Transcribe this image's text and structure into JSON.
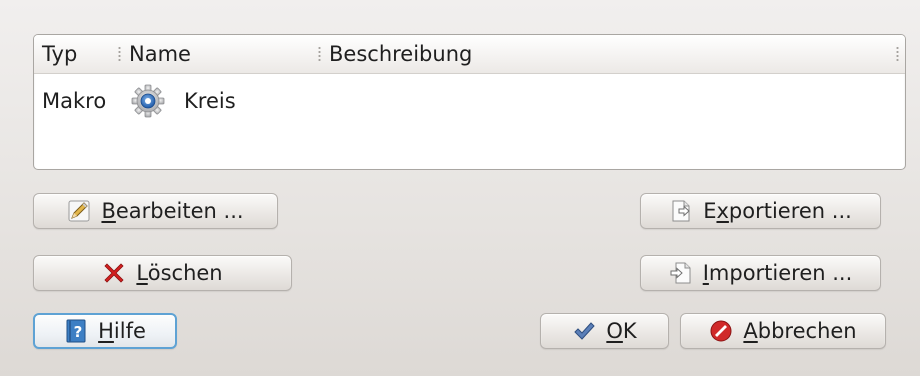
{
  "list": {
    "columns": [
      "Typ",
      "Name",
      "Beschreibung"
    ],
    "rows": [
      {
        "typ": "Makro",
        "icon": "gear-icon",
        "name": "Kreis",
        "beschreibung": ""
      }
    ]
  },
  "buttons": {
    "bearbeiten": {
      "prefix": "",
      "mnemonic": "B",
      "rest": "earbeiten ...",
      "icon": "edit-pencil-icon"
    },
    "loeschen": {
      "prefix": "",
      "mnemonic": "L",
      "rest": "öschen",
      "icon": "delete-x-icon"
    },
    "hilfe": {
      "prefix": "",
      "mnemonic": "H",
      "rest": "ilfe",
      "icon": "help-icon"
    },
    "exportieren": {
      "prefix": "E",
      "mnemonic": "x",
      "rest": "portieren ...",
      "icon": "export-icon"
    },
    "importieren": {
      "prefix": "",
      "mnemonic": "I",
      "rest": "mportieren ...",
      "icon": "import-icon"
    },
    "ok": {
      "prefix": "",
      "mnemonic": "O",
      "rest": "K",
      "icon": "checkmark-icon"
    },
    "abbrechen": {
      "prefix": "",
      "mnemonic": "A",
      "rest": "bbrechen",
      "icon": "cancel-icon"
    }
  },
  "colors": {
    "focus_border": "#5ea2d4",
    "delete_red": "#d42020",
    "ok_blue": "#4a6fa5",
    "cancel_red": "#d02a2a"
  }
}
